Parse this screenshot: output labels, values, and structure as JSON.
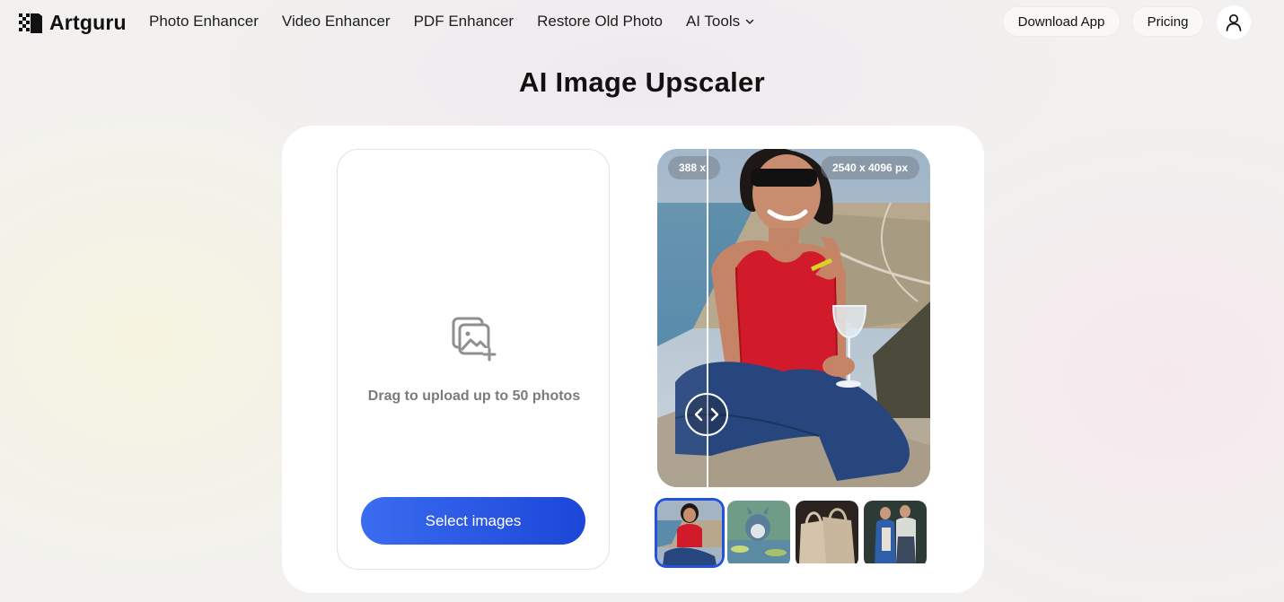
{
  "brand": {
    "name": "Artguru"
  },
  "nav": {
    "items": [
      {
        "label": "Photo Enhancer"
      },
      {
        "label": "Video Enhancer"
      },
      {
        "label": "PDF Enhancer"
      },
      {
        "label": "Restore Old Photo"
      },
      {
        "label": "AI Tools",
        "icon": "chevron-down-icon"
      }
    ],
    "download_label": "Download App",
    "pricing_label": "Pricing",
    "user_icon": "user-icon"
  },
  "page": {
    "title": "AI Image Upscaler"
  },
  "upload": {
    "icon": "add-images-icon",
    "hint": "Drag to upload up to 50 photos",
    "button_label": "Select images"
  },
  "preview": {
    "before_resolution": "388 x",
    "after_resolution": "2540 x 4096 px",
    "handle_icon": "compare-arrows-icon"
  },
  "thumbnails": [
    {
      "name": "woman-on-rock",
      "selected": true
    },
    {
      "name": "cartoon-creature"
    },
    {
      "name": "tote-bags"
    },
    {
      "name": "couple-portrait"
    }
  ],
  "colors": {
    "accent": "#2451de",
    "button_start": "#3b6cf0",
    "button_end": "#1c46d8"
  }
}
